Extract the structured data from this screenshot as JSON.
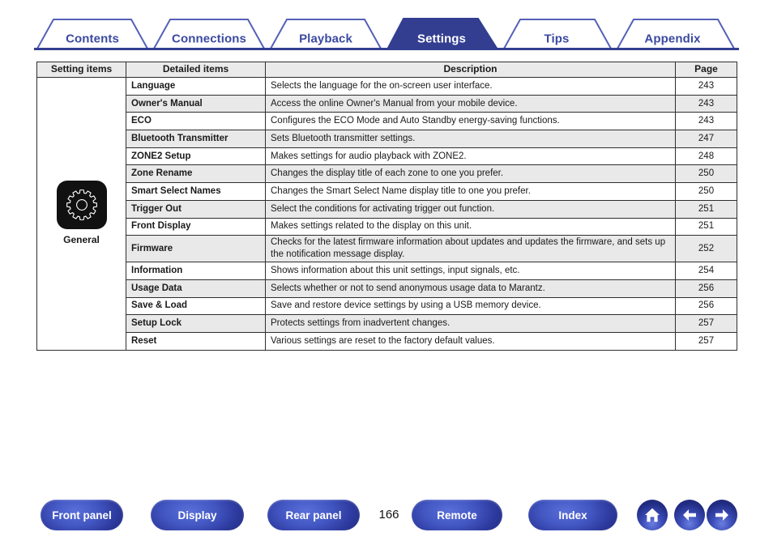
{
  "tabs": [
    {
      "label": "Contents",
      "active": false
    },
    {
      "label": "Connections",
      "active": false
    },
    {
      "label": "Playback",
      "active": false
    },
    {
      "label": "Settings",
      "active": true
    },
    {
      "label": "Tips",
      "active": false
    },
    {
      "label": "Appendix",
      "active": false
    }
  ],
  "table": {
    "headers": {
      "setting_items": "Setting items",
      "detailed_items": "Detailed items",
      "description": "Description",
      "page": "Page"
    },
    "group": {
      "icon": "gear-icon",
      "caption": "General"
    },
    "rows": [
      {
        "detailed": "Language",
        "description": "Selects the language for the on-screen user interface.",
        "page": "243"
      },
      {
        "detailed": "Owner's Manual",
        "description": "Access the online Owner's Manual from your mobile device.",
        "page": "243"
      },
      {
        "detailed": "ECO",
        "description": "Configures the ECO Mode and Auto Standby energy-saving functions.",
        "page": "243"
      },
      {
        "detailed": "Bluetooth Transmitter",
        "description": "Sets Bluetooth transmitter settings.",
        "page": "247"
      },
      {
        "detailed": "ZONE2 Setup",
        "description": "Makes settings for audio playback with ZONE2.",
        "page": "248"
      },
      {
        "detailed": "Zone Rename",
        "description": "Changes the display title of each zone to one you prefer.",
        "page": "250"
      },
      {
        "detailed": "Smart Select Names",
        "description": "Changes the Smart Select Name display title to one you prefer.",
        "page": "250"
      },
      {
        "detailed": "Trigger Out",
        "description": "Select the conditions for activating trigger out function.",
        "page": "251"
      },
      {
        "detailed": "Front Display",
        "description": "Makes settings related to the display on this unit.",
        "page": "251"
      },
      {
        "detailed": "Firmware",
        "description": "Checks for the latest firmware information about updates and updates the firmware, and sets up the notification message display.",
        "page": "252",
        "tall": true
      },
      {
        "detailed": "Information",
        "description": "Shows information about this unit settings, input signals, etc.",
        "page": "254"
      },
      {
        "detailed": "Usage Data",
        "description": "Selects whether or not to send anonymous usage data to Marantz.",
        "page": "256"
      },
      {
        "detailed": "Save & Load",
        "description": "Save and restore device settings by using a USB memory device.",
        "page": "256"
      },
      {
        "detailed": "Setup Lock",
        "description": "Protects settings from inadvertent changes.",
        "page": "257"
      },
      {
        "detailed": "Reset",
        "description": "Various settings are reset to the factory default values.",
        "page": "257"
      }
    ]
  },
  "footer": {
    "buttons": [
      {
        "label": "Front panel"
      },
      {
        "label": "Display"
      },
      {
        "label": "Rear panel"
      },
      {
        "label": "Remote"
      },
      {
        "label": "Index"
      }
    ],
    "page_number": "166",
    "icons": [
      {
        "name": "home-icon"
      },
      {
        "name": "arrow-left-icon"
      },
      {
        "name": "arrow-right-icon"
      }
    ]
  },
  "colors": {
    "tab_blue": "#333e91",
    "tab_outline": "#5560b8",
    "row_shade": "#e9e9e9",
    "header_shade": "#eaeaea",
    "border": "#2e2e2e",
    "icon_tile": "#111111"
  }
}
